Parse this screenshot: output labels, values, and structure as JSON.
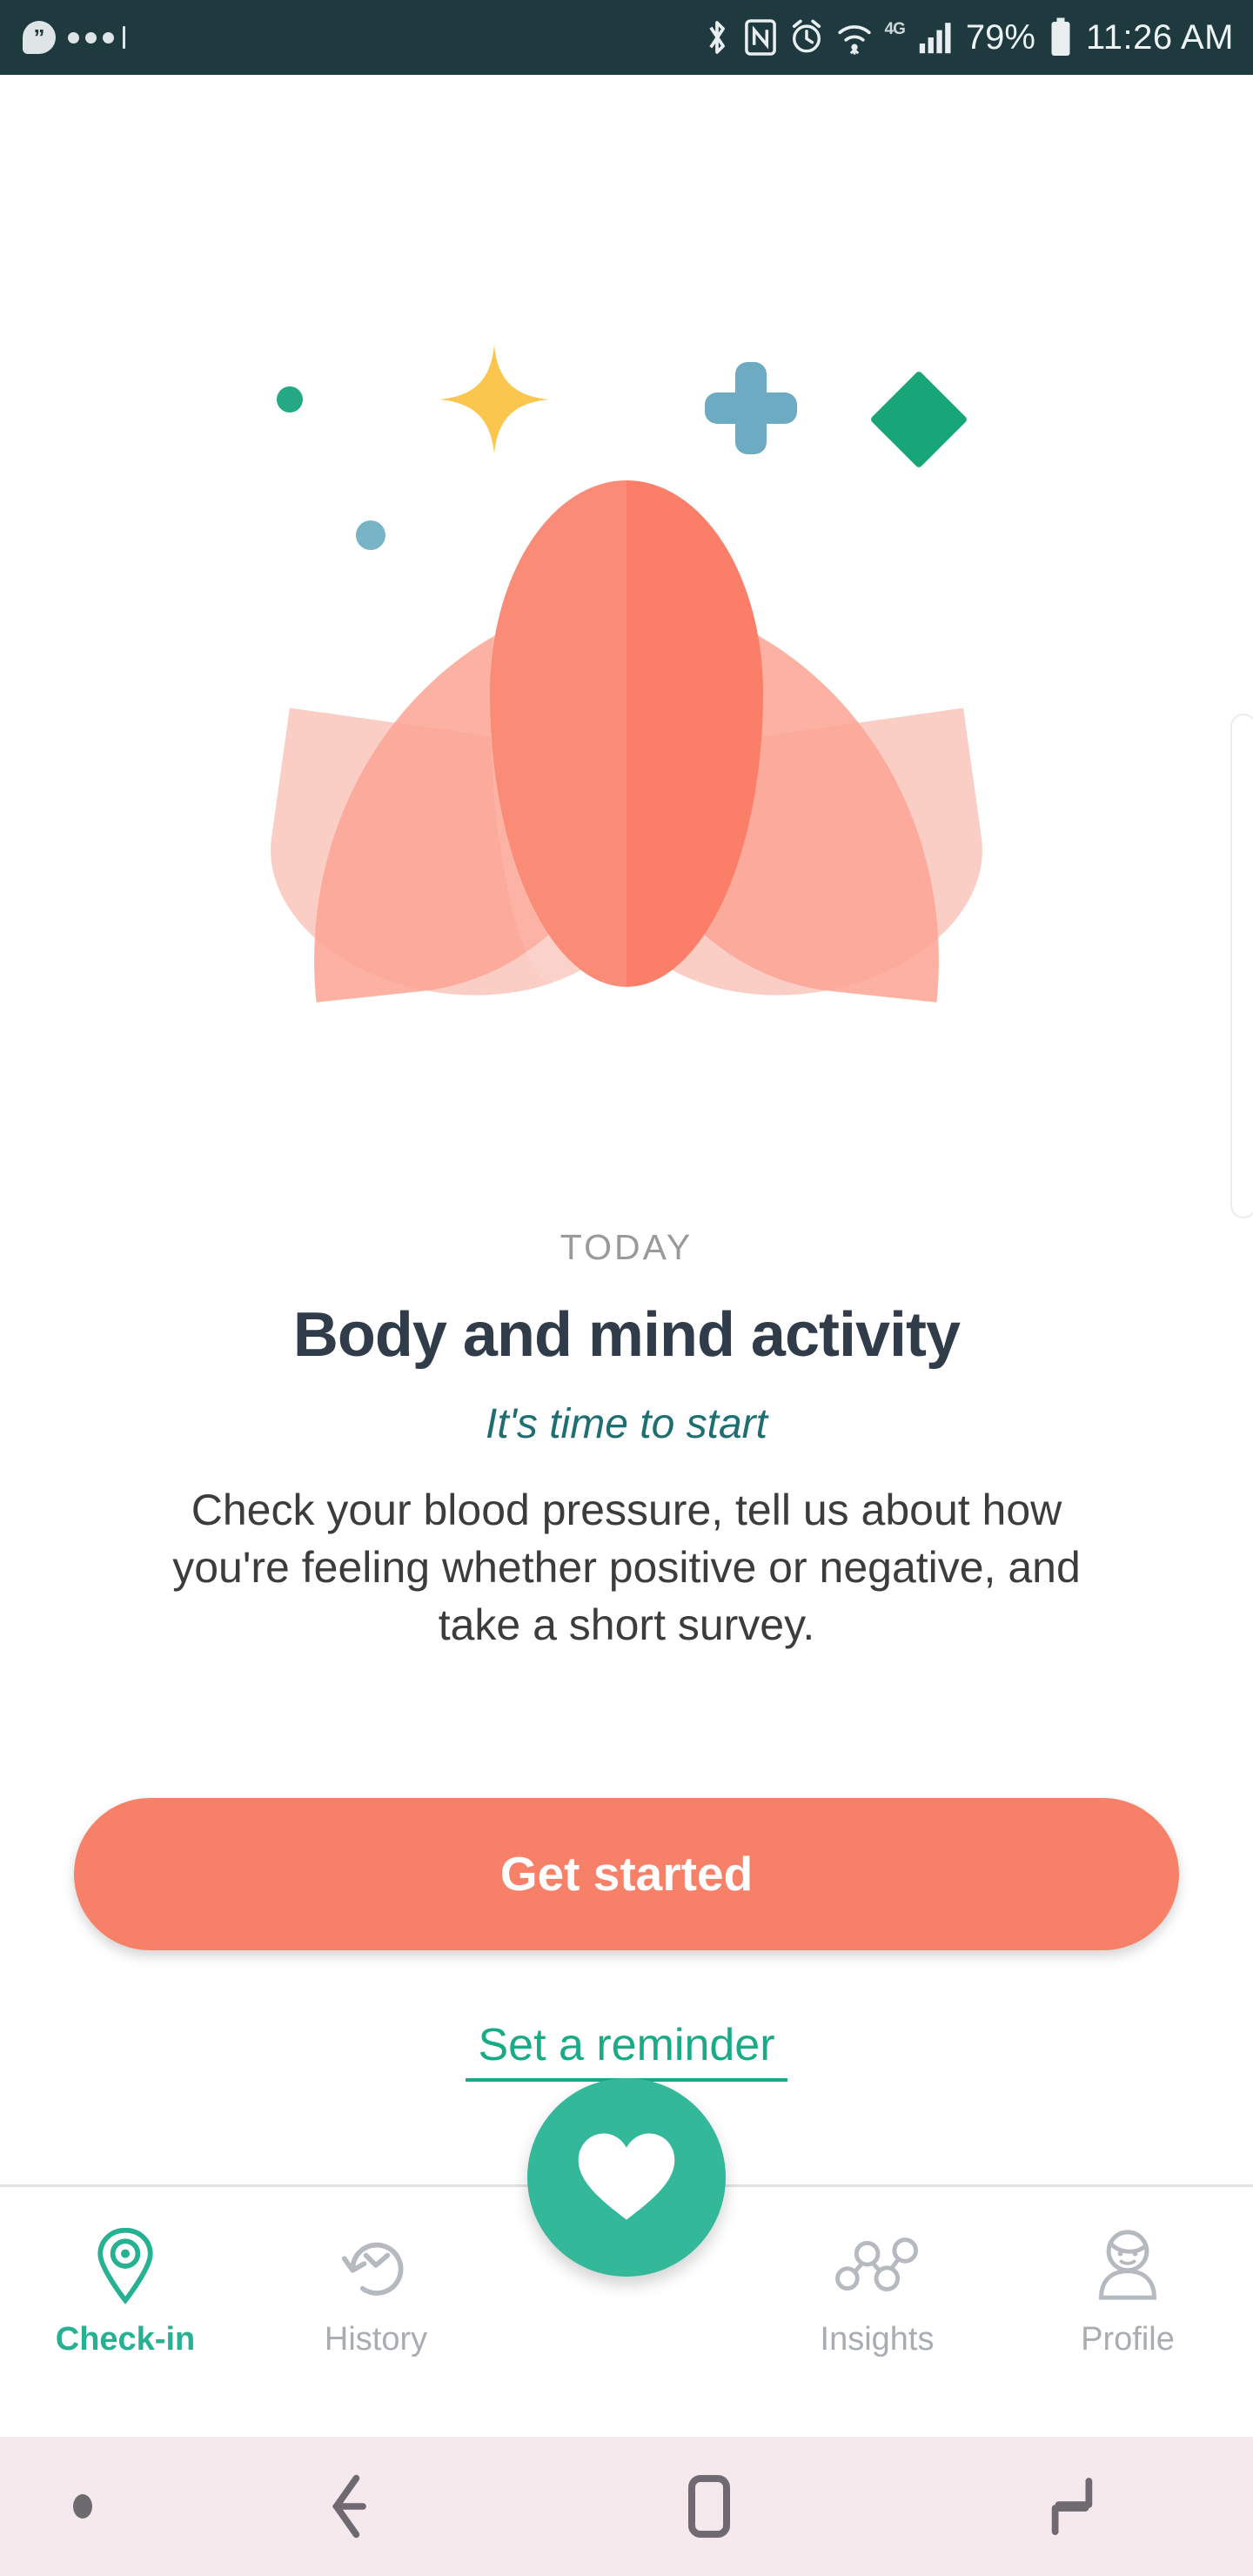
{
  "statusbar": {
    "background": "#1e3a3f",
    "notifications": [
      {
        "name": "hangouts-icon",
        "glyph": "”"
      },
      {
        "name": "more-notifications-icon",
        "glyph": "•••"
      }
    ],
    "icons": [
      {
        "name": "bluetooth-icon"
      },
      {
        "name": "nfc-icon"
      },
      {
        "name": "alarm-icon"
      },
      {
        "name": "wifi-icon"
      },
      {
        "name": "network-type-icon",
        "label": "4G"
      },
      {
        "name": "signal-icon"
      }
    ],
    "battery_percent": "79%",
    "time": "11:26 AM"
  },
  "hero": {
    "illustration": "lotus-flower-illustration",
    "decorations": [
      {
        "name": "green-dot",
        "color": "#25a884"
      },
      {
        "name": "yellow-sparkle",
        "color": "#fbc64e"
      },
      {
        "name": "blue-plus",
        "color": "#6cabc2"
      },
      {
        "name": "green-diamond",
        "color": "#18a678"
      },
      {
        "name": "blue-dot",
        "color": "#77b4c6"
      }
    ],
    "petal_colors": {
      "center": "#fa7e68",
      "mid": "#fca393",
      "outer": "#f9c2b8"
    }
  },
  "card": {
    "eyebrow": "TODAY",
    "title": "Body and mind activity",
    "subtitle": "It's time to start",
    "description": "Check your blood pressure, tell us about how you're feeling whether positive or negative, and take a short survey."
  },
  "actions": {
    "primary_label": "Get started",
    "primary_color": "#f78069",
    "secondary_label": "Set a reminder",
    "secondary_color": "#1aab86"
  },
  "bottomnav": {
    "active_color": "#25b192",
    "inactive_color": "#a8adb2",
    "items": [
      {
        "label": "Check-in",
        "icon": "location-pin-icon",
        "active": true
      },
      {
        "label": "History",
        "icon": "clock-history-icon",
        "active": false
      },
      {
        "label": "Insights",
        "icon": "network-chart-icon",
        "active": false
      },
      {
        "label": "Profile",
        "icon": "person-avatar-icon",
        "active": false
      }
    ],
    "fab": {
      "name": "heart-fab",
      "icon": "heart-icon",
      "color": "#33b89a"
    }
  },
  "androidnav": {
    "background": "#f6e9ee",
    "buttons": [
      {
        "name": "nav-dot-indicator"
      },
      {
        "name": "back-button"
      },
      {
        "name": "home-button"
      },
      {
        "name": "recents-button"
      }
    ]
  }
}
